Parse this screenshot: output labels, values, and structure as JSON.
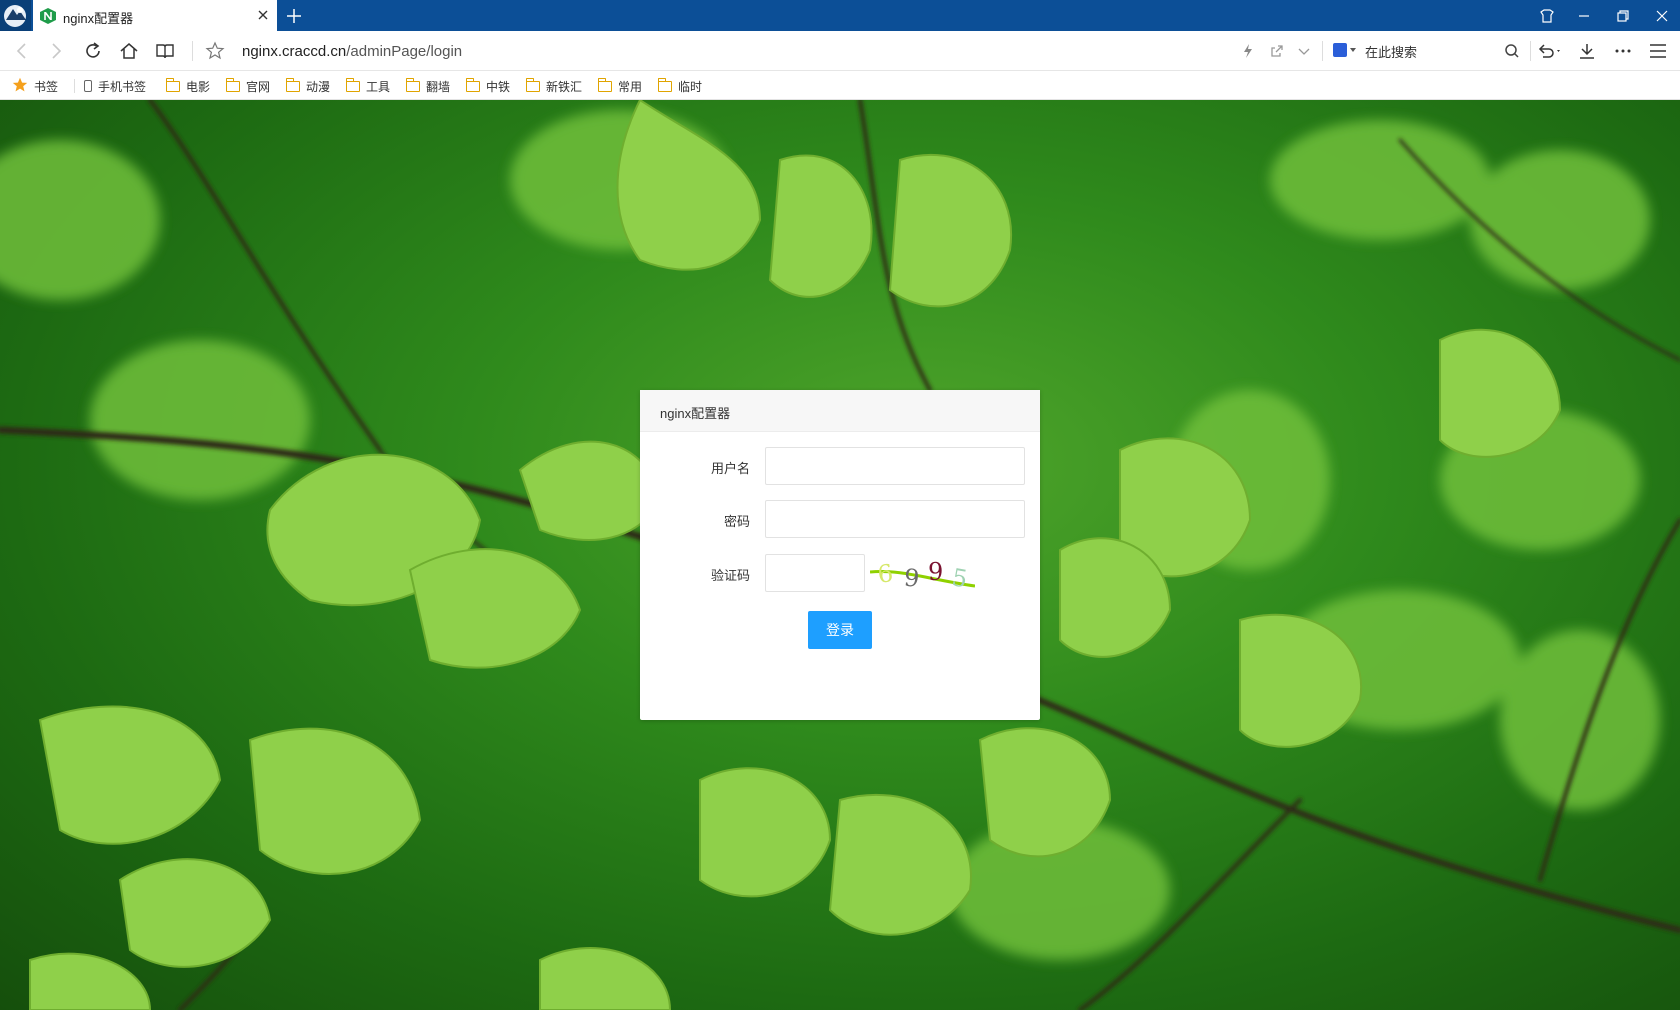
{
  "tab": {
    "title": "nginx配置器"
  },
  "toolbar": {
    "url_host": "nginx.craccd.cn",
    "url_path": "/adminPage/login"
  },
  "search": {
    "placeholder": "在此搜索"
  },
  "bookmarks": [
    {
      "label": "书签",
      "icon": "star-icon"
    },
    {
      "label": "手机书签",
      "icon": "phone-icon"
    },
    {
      "label": "电影",
      "icon": "folder-icon"
    },
    {
      "label": "官网",
      "icon": "folder-icon"
    },
    {
      "label": "动漫",
      "icon": "folder-icon"
    },
    {
      "label": "工具",
      "icon": "folder-icon"
    },
    {
      "label": "翻墙",
      "icon": "folder-icon"
    },
    {
      "label": "中铁",
      "icon": "folder-icon"
    },
    {
      "label": "新铁汇",
      "icon": "folder-icon"
    },
    {
      "label": "常用",
      "icon": "folder-icon"
    },
    {
      "label": "临时",
      "icon": "folder-icon"
    }
  ],
  "login": {
    "title": "nginx配置器",
    "username_label": "用户名",
    "password_label": "密码",
    "captcha_label": "验证码",
    "username_value": "",
    "password_value": "",
    "captcha_value": "",
    "captcha_text": "6995",
    "submit_label": "登录"
  },
  "colors": {
    "titlebar": "#0c4f97",
    "accent": "#1e9fff",
    "folder": "#e0a400"
  }
}
